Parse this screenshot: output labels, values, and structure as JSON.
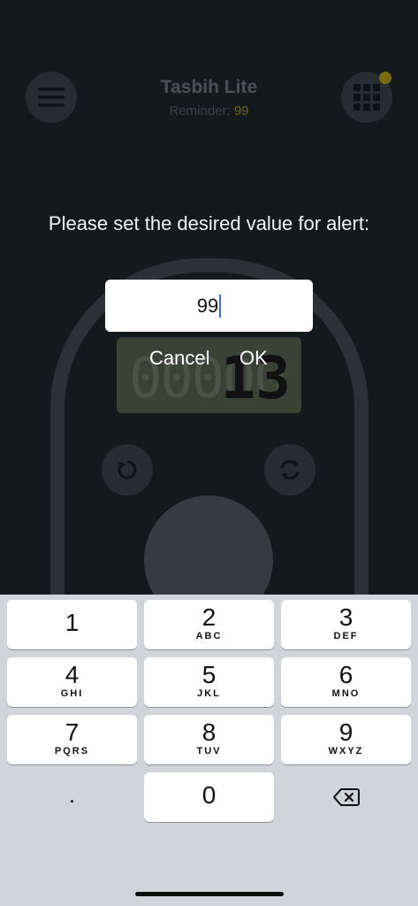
{
  "app": {
    "title": "Tasbih Lite",
    "reminder_label": "Reminder:",
    "reminder_value": "99",
    "display_ghost": "00000",
    "display_count": "13"
  },
  "dialog": {
    "message": "Please set the desired value for alert:",
    "input_value": "99",
    "cancel_label": "Cancel",
    "ok_label": "OK"
  },
  "keyboard": {
    "keys": [
      {
        "digit": "1",
        "letters": ""
      },
      {
        "digit": "2",
        "letters": "ABC"
      },
      {
        "digit": "3",
        "letters": "DEF"
      },
      {
        "digit": "4",
        "letters": "GHI"
      },
      {
        "digit": "5",
        "letters": "JKL"
      },
      {
        "digit": "6",
        "letters": "MNO"
      },
      {
        "digit": "7",
        "letters": "PQRS"
      },
      {
        "digit": "8",
        "letters": "TUV"
      },
      {
        "digit": "9",
        "letters": "WXYZ"
      },
      {
        "digit": "0",
        "letters": ""
      }
    ],
    "decimal": ".",
    "delete_icon": "backspace-icon"
  },
  "colors": {
    "caret": "#3b6fe6",
    "keyboard_bg": "#d1d4d9",
    "reminder_accent": "#6a6418"
  }
}
